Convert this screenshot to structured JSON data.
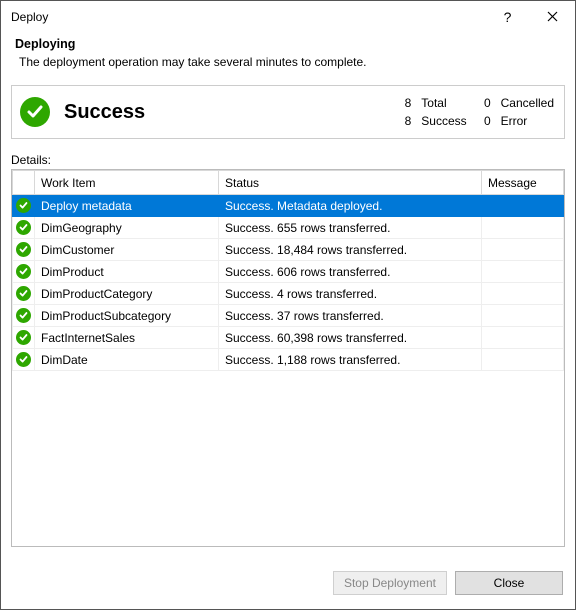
{
  "window": {
    "title": "Deploy"
  },
  "header": {
    "heading": "Deploying",
    "subtext": "The deployment operation may take several minutes to complete."
  },
  "summary": {
    "status_label": "Success",
    "counts": {
      "total_n": "8",
      "total_label": "Total",
      "cancelled_n": "0",
      "cancelled_label": "Cancelled",
      "success_n": "8",
      "success_label": "Success",
      "error_n": "0",
      "error_label": "Error"
    }
  },
  "details_label": "Details:",
  "columns": {
    "work_item": "Work Item",
    "status": "Status",
    "message": "Message"
  },
  "rows": [
    {
      "work_item": "Deploy metadata",
      "status": "Success. Metadata deployed.",
      "message": "",
      "selected": true
    },
    {
      "work_item": "DimGeography",
      "status": "Success. 655 rows transferred.",
      "message": "",
      "selected": false
    },
    {
      "work_item": "DimCustomer",
      "status": "Success. 18,484 rows transferred.",
      "message": "",
      "selected": false
    },
    {
      "work_item": "DimProduct",
      "status": "Success. 606 rows transferred.",
      "message": "",
      "selected": false
    },
    {
      "work_item": "DimProductCategory",
      "status": "Success. 4 rows transferred.",
      "message": "",
      "selected": false
    },
    {
      "work_item": "DimProductSubcategory",
      "status": "Success. 37 rows transferred.",
      "message": "",
      "selected": false
    },
    {
      "work_item": "FactInternetSales",
      "status": "Success. 60,398 rows transferred.",
      "message": "",
      "selected": false
    },
    {
      "work_item": "DimDate",
      "status": "Success. 1,188 rows transferred.",
      "message": "",
      "selected": false
    }
  ],
  "buttons": {
    "stop": "Stop Deployment",
    "close": "Close"
  }
}
